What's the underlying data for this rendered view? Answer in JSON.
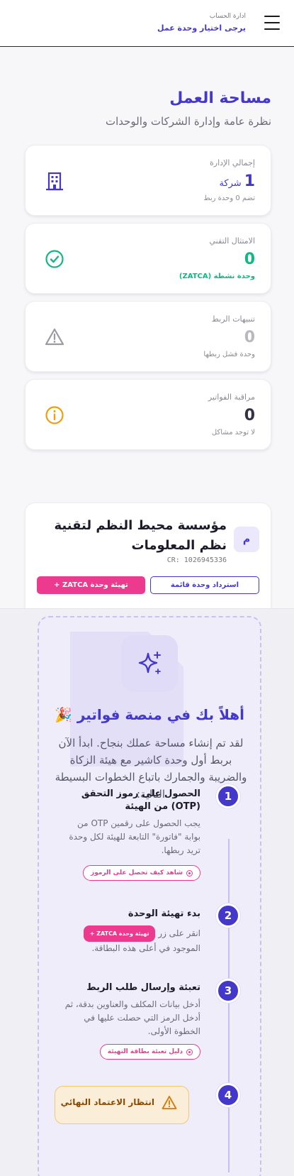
{
  "header": {
    "account_label": "ادارة الحساب",
    "unit_select": "يرجى اختيار وحدة عمل"
  },
  "page": {
    "title": "مساحة العمل",
    "subtitle": "نظرة عامة وإدارة الشركات والوحدات"
  },
  "stats": [
    {
      "label": "إجمالي الإدارة",
      "value": "1",
      "unit": "شركة",
      "note": "تضم 0 وحدة ربط",
      "value_color": "#4338ca",
      "note_color": "#8a8a96",
      "icon": "building-icon"
    },
    {
      "label": "الامتثال التقني",
      "value": "0",
      "unit": "",
      "note": "وحدة نشطة (ZATCA)",
      "value_color": "#10b981",
      "note_color": "#10b981",
      "icon": "check-circle-icon"
    },
    {
      "label": "تنبيهات الربط",
      "value": "0",
      "unit": "",
      "note": "وحدة فشل ربطها",
      "value_color": "#b8b8c0",
      "note_color": "#8a8a96",
      "icon": "warning-icon"
    },
    {
      "label": "مراقبة الفواتير",
      "value": "0",
      "unit": "",
      "note": "لا توجد مشاكل",
      "value_color": "#333344",
      "note_color": "#8a8a96",
      "icon": "info-circle-icon"
    }
  ],
  "company": {
    "avatar": "م",
    "name": "مؤسسة محيط النظم لتقنية نظم المعلومات",
    "cr": "CR: 1026945336",
    "restore_button": "استرداد وحدة قائمة",
    "init_button": "تهيئة وحدة ZATCA +"
  },
  "welcome": {
    "title": "أهلاً بك في منصة فواتير 🎉",
    "body": "لقد تم إنشاء مساحة عملك بنجاح. ابدأ الآن بربط أول وحدة كاشير مع هيئة الزكاة والضريبة والجمارك باتباع الخطوات البسيطة التالية:"
  },
  "steps": [
    {
      "num": "1",
      "title": "الحصول على رموز التحقق (OTP) من الهيئة",
      "text": "يجب الحصول على رقمين OTP من بوابة \"فاتورة\" التابعة للهيئة لكل وحدة تريد ربطها.",
      "link": "شاهد كيف تحصل على الرموز"
    },
    {
      "num": "2",
      "title": "بدء تهيئة الوحدة",
      "text_before": "انقر على زر",
      "pill": "تهيئة وحدة ZATCA +",
      "text_after": "الموجود في أعلى هذه البطاقة."
    },
    {
      "num": "3",
      "title": "تعبئة وإرسال طلب الربط",
      "text": "أدخل بيانات المكلف والعناوين بدقة، ثم أدخل الرمز التي حصلت عليها في الخطوة الأولى.",
      "link": "دليل تعبئة بطاقة التهيئة"
    },
    {
      "num": "4",
      "await_title": "انتظار الاعتماد النهائي"
    }
  ],
  "colors": {
    "accent": "#4338ca",
    "pink": "#ec3a8f",
    "success": "#10b981",
    "warning": "#f59e0b"
  }
}
